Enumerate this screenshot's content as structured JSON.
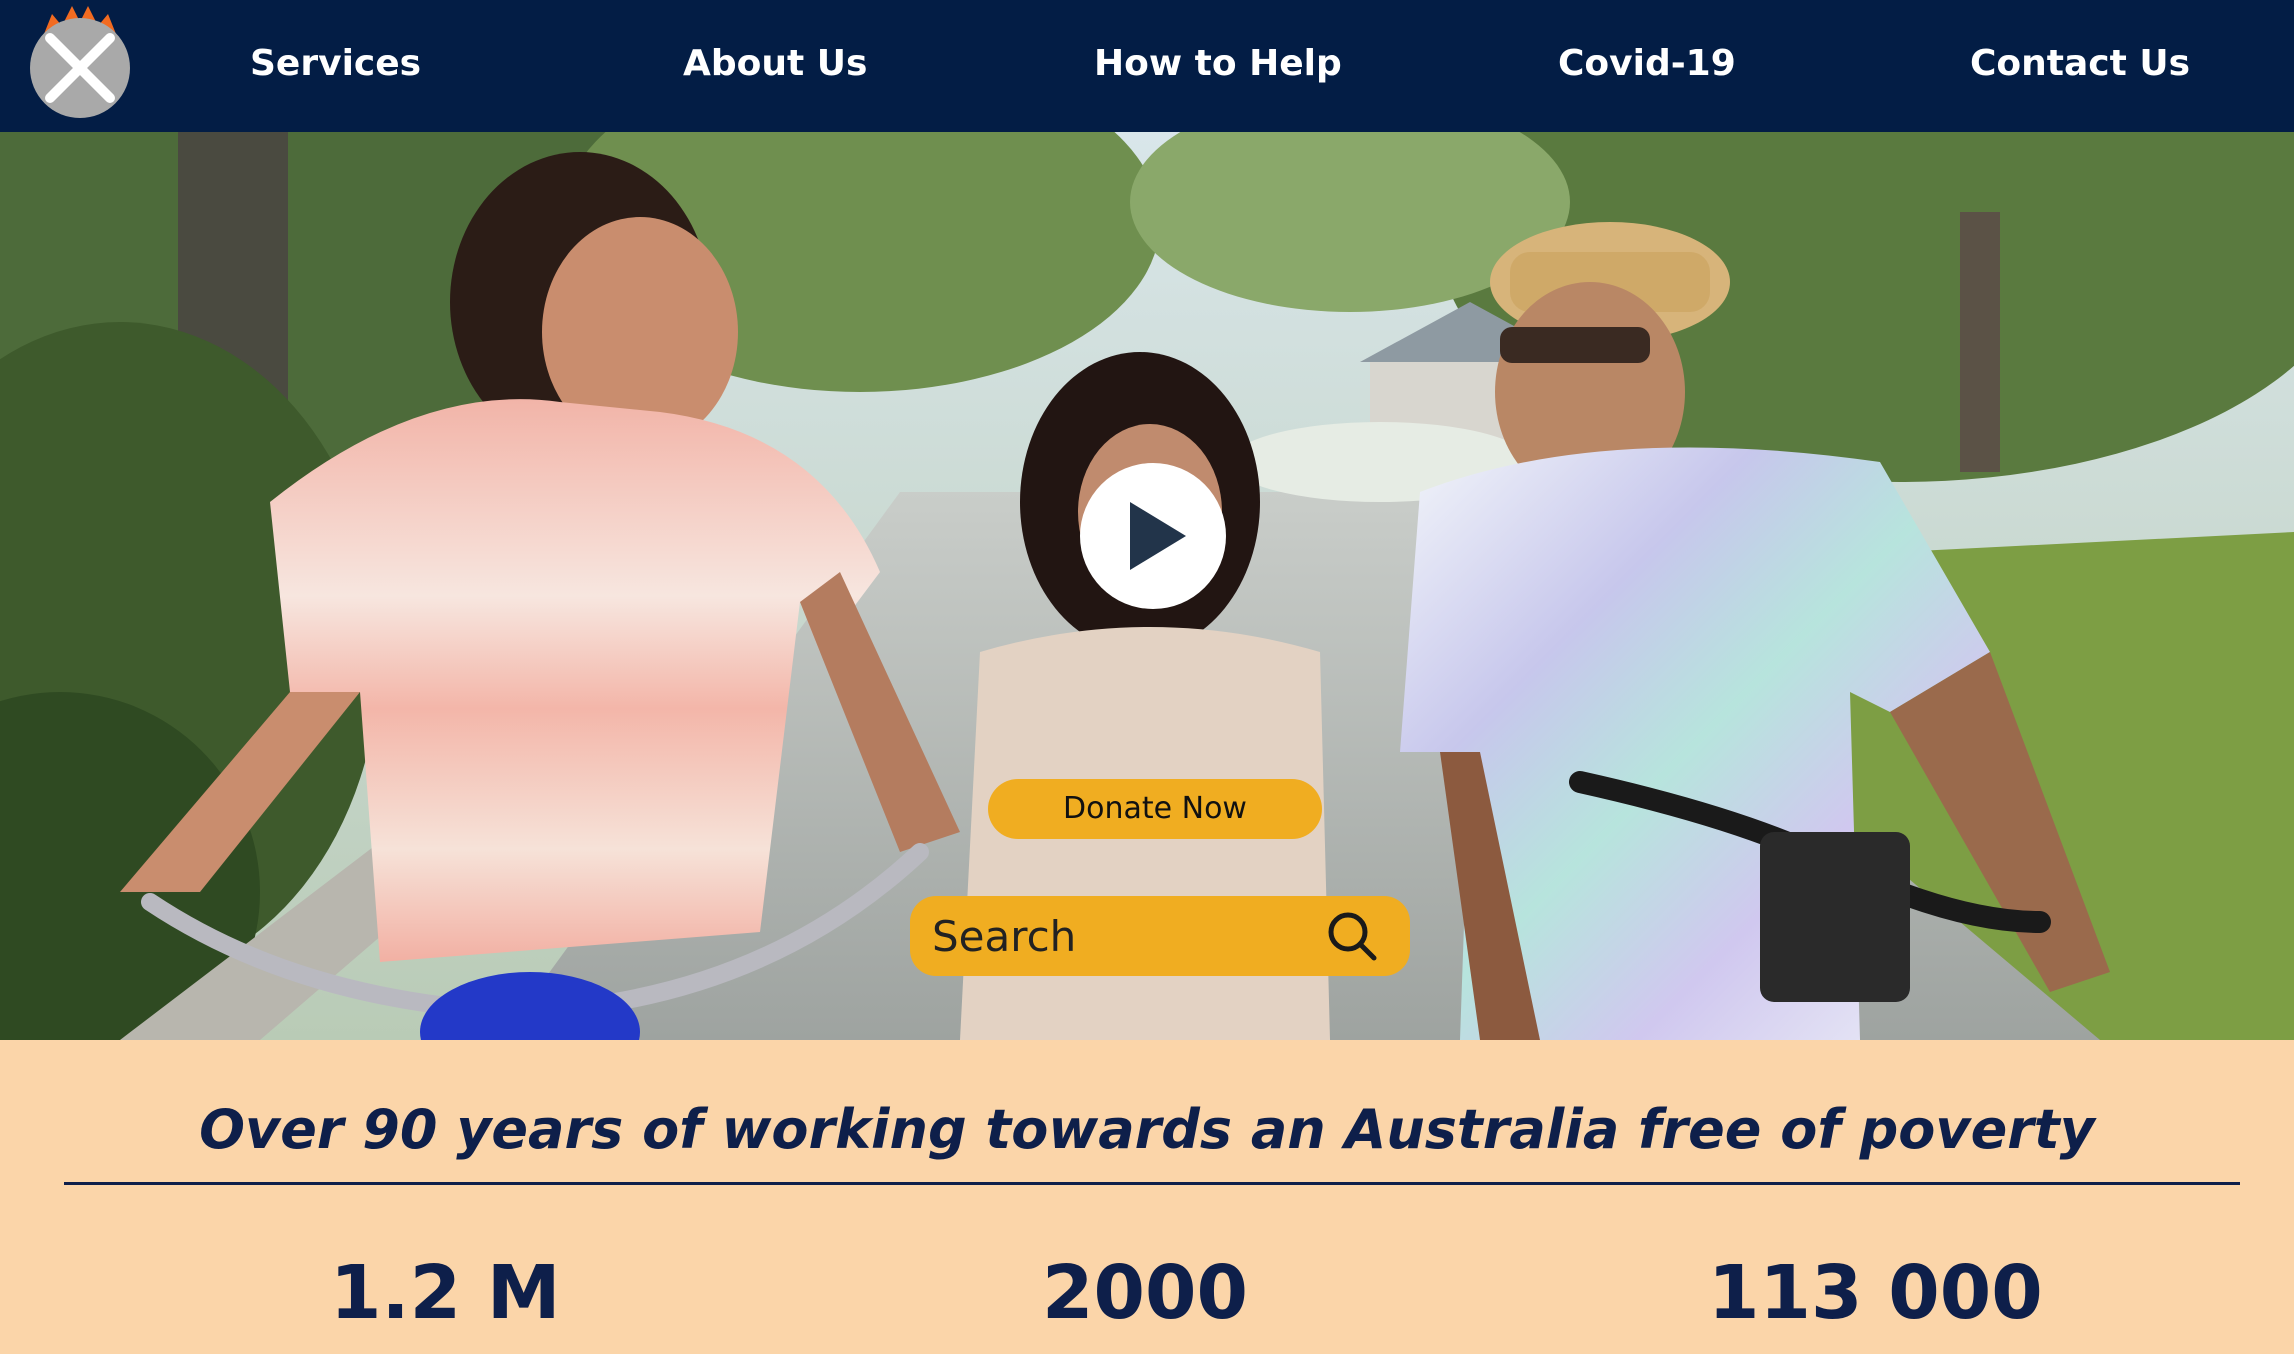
{
  "nav": {
    "logo_icon": "cross-circle-logo-icon",
    "links": [
      "Services",
      "About Us",
      "How to Help",
      "Covid-19",
      "Contact Us"
    ]
  },
  "hero": {
    "image_icon": "family-on-bicycles-photo",
    "play_icon": "play-icon",
    "donate_label": "Donate Now",
    "search_placeholder": "Search",
    "search_icon": "search-icon"
  },
  "band": {
    "tagline": "Over 90 years of working towards an Australia free of poverty",
    "stats": [
      "1.2 M",
      "2000",
      "113 000"
    ]
  },
  "colors": {
    "nav_bg": "#031d45",
    "accent": "#f0ad21",
    "band_bg": "#fbd5a9",
    "text_dark": "#0e1f4a",
    "logo_orange": "#f26b21"
  }
}
